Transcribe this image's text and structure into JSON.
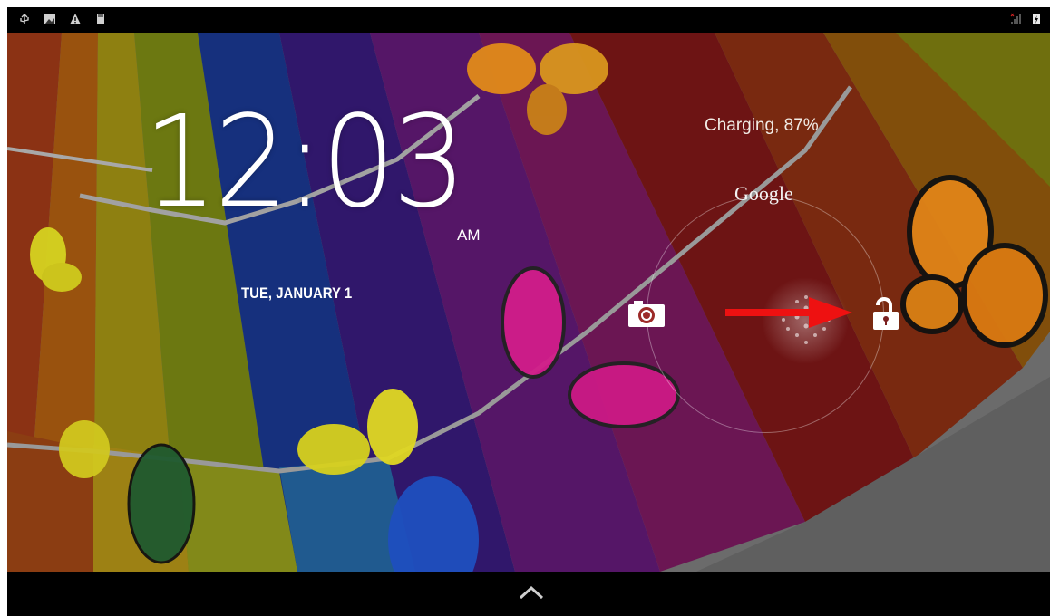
{
  "status_bar": {
    "left_icons": [
      "usb-icon",
      "screenshot-icon",
      "warning-icon",
      "sd-card-icon"
    ],
    "right_icons": [
      "signal-icon",
      "battery-charging-icon"
    ]
  },
  "lockscreen": {
    "time": "12:03",
    "ampm": "AM",
    "date": "TUE, JANUARY 1",
    "charging": "Charging, 87%",
    "search_label": "Google",
    "camera_target": "camera-icon",
    "unlock_target": "unlock-icon"
  },
  "navigation": {
    "up_icon": "chevron-up-icon"
  },
  "colors": {
    "annotation_arrow": "#ee1111",
    "status_bar": "#000000"
  }
}
